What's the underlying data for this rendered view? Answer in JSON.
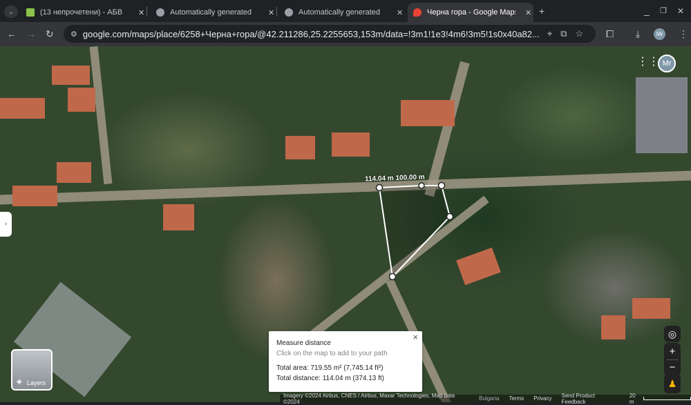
{
  "tabs": [
    {
      "title": "(13 непрочетени) - АБВ",
      "color": "#8bc34a"
    },
    {
      "title": "Automatically generated",
      "color": "#9aa0a6"
    },
    {
      "title": "Automatically generated",
      "color": "#9aa0a6"
    },
    {
      "title": "Черна гора - Google Maps",
      "color": "#ea4335",
      "active": true
    }
  ],
  "url": "google.com/maps/place/6258+Черна+гора/@42.211286,25.2255653,153m/data=!3m1!1e3!4m6!3m5!1s0x40a82...",
  "profile": "Mr",
  "measure": {
    "label_total": "114.04 m",
    "label_segment": "100.00 m",
    "title": "Measure distance",
    "hint": "Click on the map to add to your path",
    "area": "Total area: 719.55 m² (7,745.14 ft²)",
    "distance": "Total distance: 114.04 m (374.13 ft)"
  },
  "layers_label": "Layers",
  "footer": {
    "imagery": "Imagery ©2024 Airbus, CNES / Airbus, Maxar Technologies, Map data ©2024",
    "country": "Bulgaria",
    "terms": "Terms",
    "privacy": "Privacy",
    "feedback": "Send Product Feedback",
    "scale": "20 m"
  }
}
